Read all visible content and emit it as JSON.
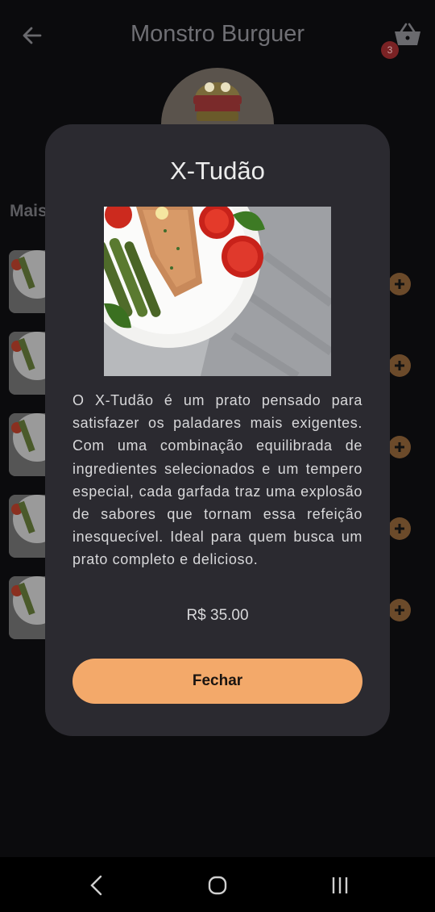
{
  "header": {
    "title": "Monstro Burguer",
    "back_icon": "arrow-left-icon",
    "cart_icon": "basket-icon",
    "cart_count": "3"
  },
  "section": {
    "label": "Mais"
  },
  "dialog": {
    "title": "X-Tudão",
    "description": "O X-Tudão é um prato pensado para satisfazer os paladares mais exigentes. Com uma combinação equilibrada de ingredientes selecionados e um tempero especial, cada garfada traz uma explosão de sabores que tornam essa refeição inesquecível. Ideal para quem busca um prato completo e delicioso.",
    "price": "R$ 35.00",
    "close_label": "Fechar"
  },
  "products": [
    {
      "add_icon": "plus-circle-icon"
    },
    {
      "add_icon": "plus-circle-icon"
    },
    {
      "add_icon": "plus-circle-icon"
    },
    {
      "add_icon": "plus-circle-icon"
    },
    {
      "add_icon": "plus-circle-icon"
    }
  ],
  "colors": {
    "accent": "#f3a96a",
    "dialog_bg": "#2b2a30",
    "background": "#0b0b0d",
    "badge": "#c0392b"
  },
  "system_nav": {
    "back_icon": "chevron-left-icon",
    "home_icon": "home-circle-icon",
    "recents_icon": "recents-bars-icon"
  }
}
